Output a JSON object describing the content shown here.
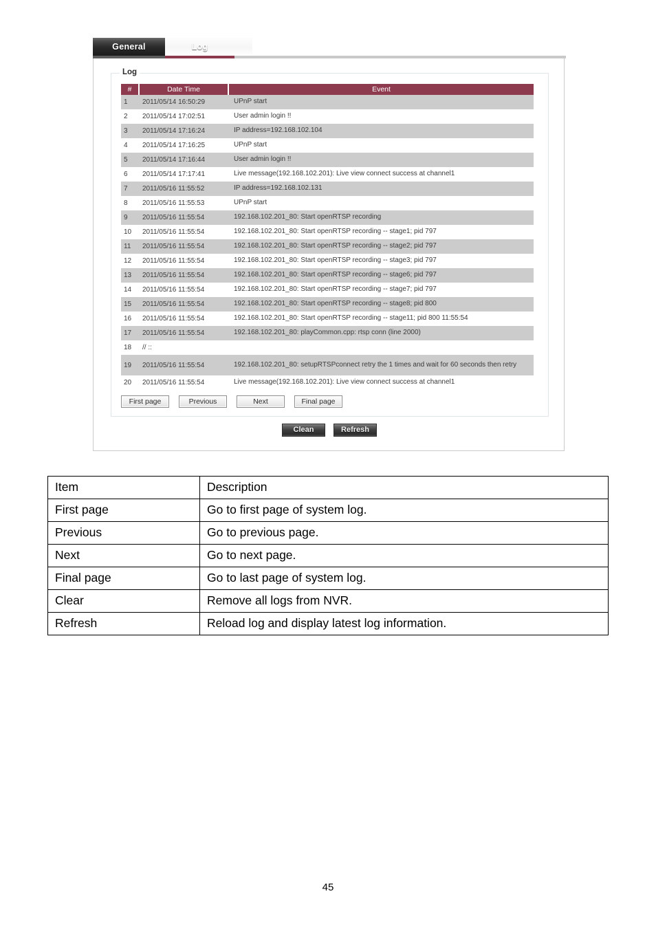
{
  "colors": {
    "accent_maroon": "#8e3a4e",
    "row_stripe": "#cccccc",
    "panel_border": "#c9c9c9",
    "fieldset_border": "#dfe6ea"
  },
  "tabs": [
    {
      "label": "General",
      "active": false
    },
    {
      "label": "Log",
      "active": true
    }
  ],
  "fieldset": {
    "legend": "Log"
  },
  "log_table": {
    "headers": [
      "#",
      "Date Time",
      "Event"
    ],
    "rows": [
      {
        "num": "1",
        "datetime": "2011/05/14 16:50:29",
        "event": "UPnP start"
      },
      {
        "num": "2",
        "datetime": "2011/05/14 17:02:51",
        "event": "User admin login !!"
      },
      {
        "num": "3",
        "datetime": "2011/05/14 17:16:24",
        "event": "IP address=192.168.102.104"
      },
      {
        "num": "4",
        "datetime": "2011/05/14 17:16:25",
        "event": "UPnP start"
      },
      {
        "num": "5",
        "datetime": "2011/05/14 17:16:44",
        "event": "User admin login !!"
      },
      {
        "num": "6",
        "datetime": "2011/05/14 17:17:41",
        "event": "Live message(192.168.102.201): Live view connect success at channel1"
      },
      {
        "num": "7",
        "datetime": "2011/05/16 11:55:52",
        "event": "IP address=192.168.102.131"
      },
      {
        "num": "8",
        "datetime": "2011/05/16 11:55:53",
        "event": "UPnP start"
      },
      {
        "num": "9",
        "datetime": "2011/05/16 11:55:54",
        "event": "192.168.102.201_80: Start openRTSP recording"
      },
      {
        "num": "10",
        "datetime": "2011/05/16 11:55:54",
        "event": "192.168.102.201_80: Start openRTSP recording -- stage1; pid 797"
      },
      {
        "num": "11",
        "datetime": "2011/05/16 11:55:54",
        "event": "192.168.102.201_80: Start openRTSP recording -- stage2; pid 797"
      },
      {
        "num": "12",
        "datetime": "2011/05/16 11:55:54",
        "event": "192.168.102.201_80: Start openRTSP recording -- stage3; pid 797"
      },
      {
        "num": "13",
        "datetime": "2011/05/16 11:55:54",
        "event": "192.168.102.201_80: Start openRTSP recording -- stage6; pid 797"
      },
      {
        "num": "14",
        "datetime": "2011/05/16 11:55:54",
        "event": "192.168.102.201_80: Start openRTSP recording -- stage7; pid 797"
      },
      {
        "num": "15",
        "datetime": "2011/05/16 11:55:54",
        "event": "192.168.102.201_80: Start openRTSP recording -- stage8; pid 800"
      },
      {
        "num": "16",
        "datetime": "2011/05/16 11:55:54",
        "event": "192.168.102.201_80: Start openRTSP recording -- stage11; pid 800 11:55:54"
      },
      {
        "num": "17",
        "datetime": "2011/05/16 11:55:54",
        "event": "192.168.102.201_80: playCommon.cpp: rtsp conn (line 2000)"
      },
      {
        "num": "18",
        "datetime": "// ::",
        "event": ""
      },
      {
        "num": "19",
        "datetime": "2011/05/16 11:55:54",
        "event": "192.168.102.201_80: setupRTSPconnect retry the 1 times and wait for 60 seconds then retry"
      },
      {
        "num": "20",
        "datetime": "2011/05/16 11:55:54",
        "event": "Live message(192.168.102.201): Live view connect success at channel1"
      }
    ]
  },
  "pager": {
    "first": "First page",
    "previous": "Previous",
    "next": "Next",
    "final": "Final page"
  },
  "actions": {
    "clean": "Clean",
    "refresh": "Refresh"
  },
  "description_table": {
    "headers": [
      "Item",
      "Description"
    ],
    "rows": [
      {
        "item": "First page",
        "description": "Go to first page of system log."
      },
      {
        "item": "Previous",
        "description": "Go to previous page."
      },
      {
        "item": "Next",
        "description": "Go to next page."
      },
      {
        "item": "Final page",
        "description": "Go to last page of system log."
      },
      {
        "item": "Clear",
        "description": "Remove all logs from NVR."
      },
      {
        "item": "Refresh",
        "description": "Reload log and display latest log information."
      }
    ]
  },
  "page_number": "45"
}
